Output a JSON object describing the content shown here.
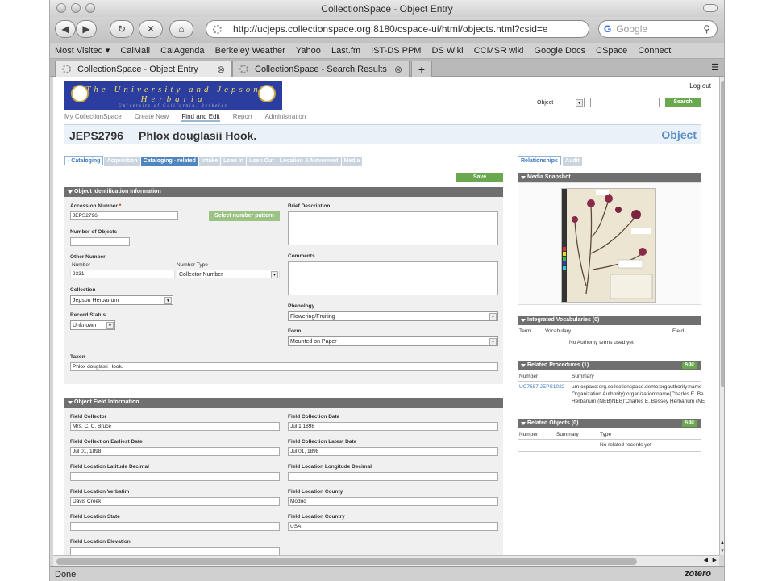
{
  "window": {
    "title": "CollectionSpace - Object Entry"
  },
  "navbar": {
    "url": "http://ucjeps.collectionspace.org:8180/cspace-ui/html/objects.html?csid=e",
    "search_placeholder": "Google"
  },
  "bookmarks": [
    "Most Visited ▾",
    "CalMail",
    "CalAgenda",
    "Berkeley Weather",
    "Yahoo",
    "Last.fm",
    "IST-DS PPM",
    "DS Wiki",
    "CCMSR wiki",
    "Google Docs",
    "CSpace",
    "Connect"
  ],
  "tabs": [
    {
      "label": "CollectionSpace - Object Entry"
    },
    {
      "label": "CollectionSpace - Search Results"
    }
  ],
  "header": {
    "logo_line1": "The University and Jepson",
    "logo_line2": "Herbaria",
    "logo_line3": "University of California, Berkeley",
    "logout": "Log out",
    "search_type": "Object",
    "search_button": "Search"
  },
  "mainnav": [
    "My CollectionSpace",
    "Create New",
    "Find and Edit",
    "Report",
    "Administration"
  ],
  "record": {
    "id": "JEPS2796",
    "taxon": "Phlox douglasii Hook.",
    "type": "Object"
  },
  "record_tabs": [
    "- Cataloging",
    "Acquisition",
    "Cataloging - related",
    "Intake",
    "Loan In",
    "Loan Out",
    "Location & Movement",
    "Media"
  ],
  "form": {
    "save": "Save",
    "section1": "Object Identification Information",
    "accession_label": "Accession Number",
    "required_star": "*",
    "accession_value": "JEPS2796",
    "select_pattern": "Select number pattern",
    "num_objects_label": "Number of Objects",
    "other_number_label": "Other Number",
    "number_col": "Number",
    "number_type_col": "Number Type",
    "other_number_value": "2331",
    "other_number_type": "Collector Number",
    "collection_label": "Collection",
    "collection_value": "Jepson Herbarium",
    "record_status_label": "Record Status",
    "record_status_value": "Unknown",
    "taxon_label": "Taxon",
    "taxon_value": "Phlox douglasii Hook.",
    "brief_desc_label": "Brief Description",
    "comments_label": "Comments",
    "phenology_label": "Phenology",
    "phenology_value": "Flowering/Fruiting",
    "form_label": "Form",
    "form_value": "Mounted on Paper",
    "section2": "Object Field Information",
    "field_collector_label": "Field Collector",
    "field_collector_value": "Mrs. C. C. Bruce",
    "field_collection_date_label": "Field Collection Date",
    "field_collection_date_value": "Jul  1 1898",
    "earliest_date_label": "Field Collection Earliest Date",
    "earliest_date_value": "Jul 01, 1898",
    "latest_date_label": "Field Collection Latest Date",
    "latest_date_value": "Jul 01, 1898",
    "lat_label": "Field Location Latitude Decimal",
    "lon_label": "Field Location Longitude Decimal",
    "verbatim_label": "Field Location Verbatim",
    "verbatim_value": "Davis Creek",
    "county_label": "Field Location County",
    "county_value": "Modoc",
    "state_label": "Field Location State",
    "country_label": "Field Location Country",
    "country_value": "USA",
    "elevation_label": "Field Location Elevation"
  },
  "right": {
    "tab_relationships": "Relationships",
    "tab_audit": "Audit",
    "media_snapshot": "Media Snapshot",
    "integrated_vocab": "Integrated Vocabularies (0)",
    "iv_cols": [
      "Term",
      "Vocabulary",
      "Field"
    ],
    "iv_empty": "No Authority terms used yet",
    "related_procedures": "Related Procedures (1)",
    "rp_cols": [
      "Number",
      "Summary"
    ],
    "rp_number": "UC7587.JEPS1022",
    "rp_summary1": "urn:cspace:org.collectionspace.demo:orgauthority:name",
    "rp_summary2": "Organization Authority):organization:name(Charles E. Be",
    "rp_summary3": "Herbarium (NEB)NEB)'Charles E. Bessey Herbarium (NE",
    "add": "Add",
    "related_objects": "Related Objects (0)",
    "ro_cols": [
      "Number",
      "Summary",
      "Type"
    ],
    "ro_empty": "No related records yet"
  },
  "status": {
    "left": "Done",
    "right": "zotero"
  },
  "colors": {
    "accent_green": "#6aa84f",
    "section_gray": "#6f6f6f",
    "link_blue": "#3a78b8",
    "logo_blue": "#2b3ea0"
  }
}
